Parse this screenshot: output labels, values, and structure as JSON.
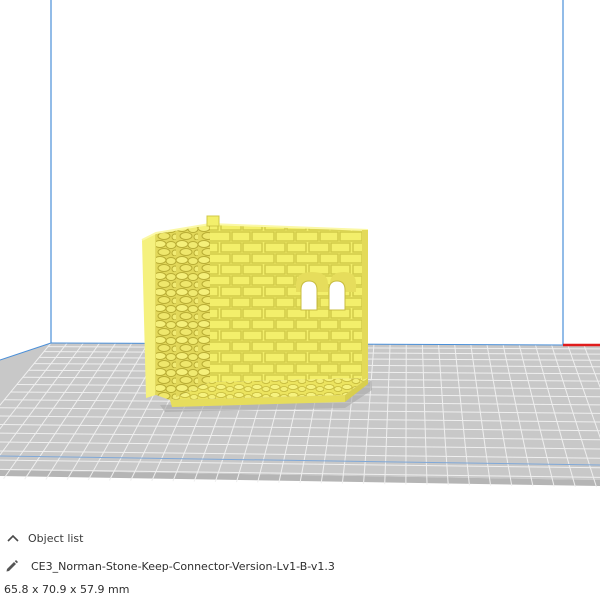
{
  "viewport": {
    "background_color": "#ffffff",
    "build_volume_edge_color": "#4a8fd8",
    "build_plate_color": "#c8c8c8",
    "build_plate_grid_color": "#efefef",
    "x_axis_color": "#e01c1c",
    "model_color": "#f3ef6b",
    "model_shadow_color": "#d3c846"
  },
  "object_list": {
    "label": "Object list",
    "toggle_icon": "chevron-up-icon"
  },
  "object": {
    "edit_icon": "pencil-icon",
    "name": "CE3_Norman-Stone-Keep-Connector-Version-Lv1-B-v1.3",
    "dimensions": "65.8 x 70.9 x 57.9 mm"
  }
}
